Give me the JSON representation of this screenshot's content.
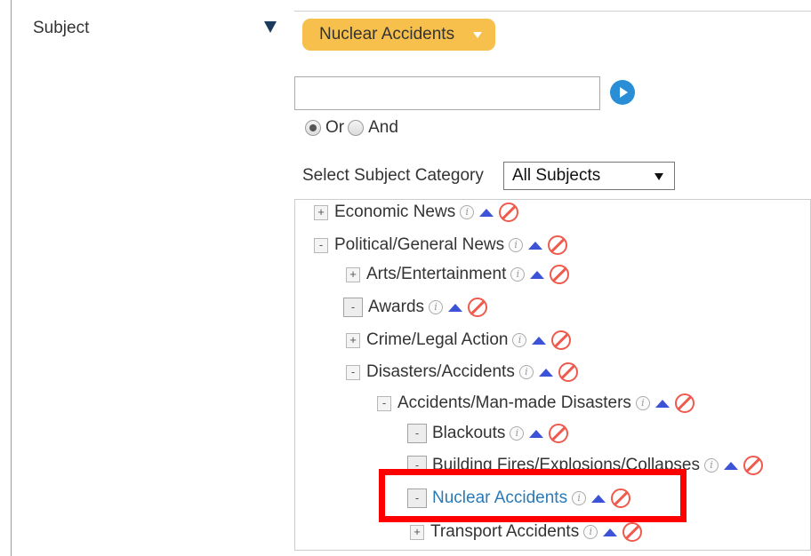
{
  "subject": {
    "label": "Subject",
    "selected_tag": "Nuclear Accidents"
  },
  "search": {
    "value": "",
    "placeholder": ""
  },
  "logic": {
    "options": [
      "Or",
      "And"
    ],
    "selected": "Or"
  },
  "category": {
    "label": "Select Subject Category",
    "selected": "All Subjects"
  },
  "tree": {
    "items": [
      {
        "toggle": "+",
        "label": "Economic News"
      },
      {
        "toggle": "-",
        "label": "Political/General News"
      },
      {
        "toggle": "+",
        "label": "Arts/Entertainment"
      },
      {
        "toggle": "-",
        "label": "Awards"
      },
      {
        "toggle": "+",
        "label": "Crime/Legal Action"
      },
      {
        "toggle": "-",
        "label": "Disasters/Accidents"
      },
      {
        "toggle": "-",
        "label": "Accidents/Man-made Disasters"
      },
      {
        "toggle": "-",
        "label": "Blackouts"
      },
      {
        "toggle": "-",
        "label": "Building Fires/Explosions/Collapses"
      },
      {
        "toggle": "-",
        "label": "Nuclear Accidents"
      },
      {
        "toggle": "+",
        "label": "Transport Accidents"
      }
    ]
  },
  "icons": {
    "info": "i",
    "info_name": "info-icon",
    "up_name": "move-up-icon",
    "exclude_name": "exclude-icon"
  },
  "colors": {
    "accent_pill": "#f7c04c",
    "link": "#2a7ab8",
    "up_arrow": "#3c53d8",
    "exclude": "#ef5a4d",
    "highlight": "#ff0000"
  }
}
